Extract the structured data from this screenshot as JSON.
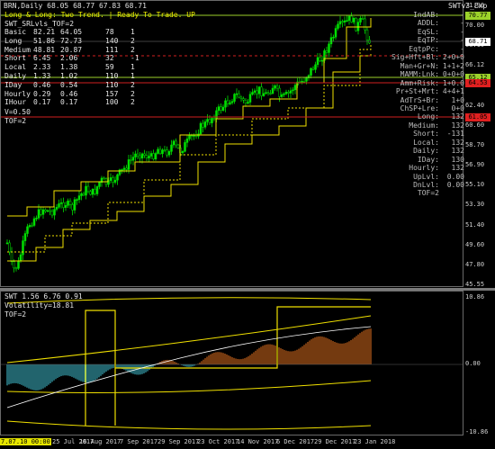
{
  "window": {
    "symbol_title": "BRN,Daily  68.05 68.77 67.83 68.71",
    "expert_label": "SWTv3_Exp",
    "status_line": "Long & Long: Two Trend. |  Ready To Trade. UP",
    "indicator_title": "SWT_SRLvls_TOF=2"
  },
  "stats_table": {
    "rows": [
      {
        "label": "Basic",
        "c1": "82.21",
        "c2": "64.05",
        "c3": "78",
        "c4": "1"
      },
      {
        "label": "Long",
        "c1": "51.86",
        "c2": "72.73",
        "c3": "140",
        "c4": "2"
      },
      {
        "label": "Medium",
        "c1": "48.81",
        "c2": "20.87",
        "c3": "111",
        "c4": "2"
      },
      {
        "label": "Short",
        "c1": "6.45",
        "c2": "2.06",
        "c3": "32",
        "c4": "-1"
      },
      {
        "label": "Local",
        "c1": "2.33",
        "c2": "1.38",
        "c3": "59",
        "c4": "1"
      },
      {
        "label": "Daily",
        "c1": "1.33",
        "c2": "1.02",
        "c3": "110",
        "c4": "1"
      },
      {
        "label": "IDay",
        "c1": "0.46",
        "c2": "0.54",
        "c3": "110",
        "c4": "2"
      },
      {
        "label": "Hourly",
        "c1": "0.29",
        "c2": "0.46",
        "c3": "157",
        "c4": "2"
      },
      {
        "label": "IHour",
        "c1": "0.17",
        "c2": "0.17",
        "c3": "100",
        "c4": "2"
      }
    ],
    "footer1": "V=0.50",
    "footer2": "TOF=2"
  },
  "right_panel": {
    "rows": [
      {
        "label": "IndAB:",
        "value": "-"
      },
      {
        "label": "ADDL:",
        "value": "-"
      },
      {
        "label": "EqSL:",
        "value": "-"
      },
      {
        "label": "EqTP:",
        "value": "-"
      },
      {
        "label": "EqtpPc:",
        "value": "-"
      },
      {
        "label": "Sig+Hft+Bl:",
        "value": "2+0+0"
      },
      {
        "label": "Man+Gr+N:",
        "value": "1+1+2"
      },
      {
        "label": "MAMM:Lnk:",
        "value": "0+0+0"
      },
      {
        "label": "Amm+Risk:",
        "value": "1+0.0"
      },
      {
        "label": "Pr+St+Mrt:",
        "value": "4+4+1"
      },
      {
        "label": "AdTrS+Br:",
        "value": "1+0"
      },
      {
        "label": "ChSP+Lre:",
        "value": "0+0"
      },
      {
        "label": "Long:",
        "value": "132"
      },
      {
        "label": "Medium:",
        "value": "132"
      },
      {
        "label": "Short:",
        "value": "-131"
      },
      {
        "label": "Local:",
        "value": "132"
      },
      {
        "label": "Daily:",
        "value": "132"
      },
      {
        "label": "IDay:",
        "value": "130"
      },
      {
        "label": "Hourly:",
        "value": "132"
      },
      {
        "label": "UpLvl:",
        "value": "0.00"
      },
      {
        "label": "DnLvl:",
        "value": "0.00"
      },
      {
        "label": "TOF=2",
        "value": ""
      }
    ]
  },
  "price_axis": {
    "labels": [
      "71.90",
      "70.00",
      "68.10",
      "66.12",
      "64.20",
      "62.40",
      "60.60",
      "58.70",
      "56.90",
      "55.10",
      "53.30",
      "51.40",
      "49.60",
      "47.80",
      "45.55"
    ],
    "boxes": [
      {
        "text": "70.77",
        "color": "#9bd12a"
      },
      {
        "text": "68.71",
        "color": "#ffffff"
      },
      {
        "text": "65.12",
        "color": "#9bd12a"
      },
      {
        "text": "64.53",
        "color": "#e02020"
      },
      {
        "text": "61.05",
        "color": "#e02020"
      }
    ]
  },
  "sub_window": {
    "title": "SWT 1.56 6.76 0.91",
    "volatility": "Volatility=18.81",
    "tof": "TOF=2",
    "axis": [
      "10.86",
      "0.00",
      "-10.86"
    ]
  },
  "time_axis": {
    "first_label": "7.07.10 00:00",
    "labels": [
      "25 Jul 2017",
      "16 Aug 2017",
      "7 Sep 2017",
      "29 Sep 2017",
      "23 Oct 2017",
      "14 Nov 2017",
      "6 Dec 2017",
      "29 Dec 2017",
      "23 Jan 2018"
    ]
  },
  "colors": {
    "bull": "#00e000",
    "bear": "#000000",
    "level": "#f0e000",
    "resistance_red": "#d02020",
    "teal": "#3fb7c6",
    "orange": "#d2691e"
  }
}
